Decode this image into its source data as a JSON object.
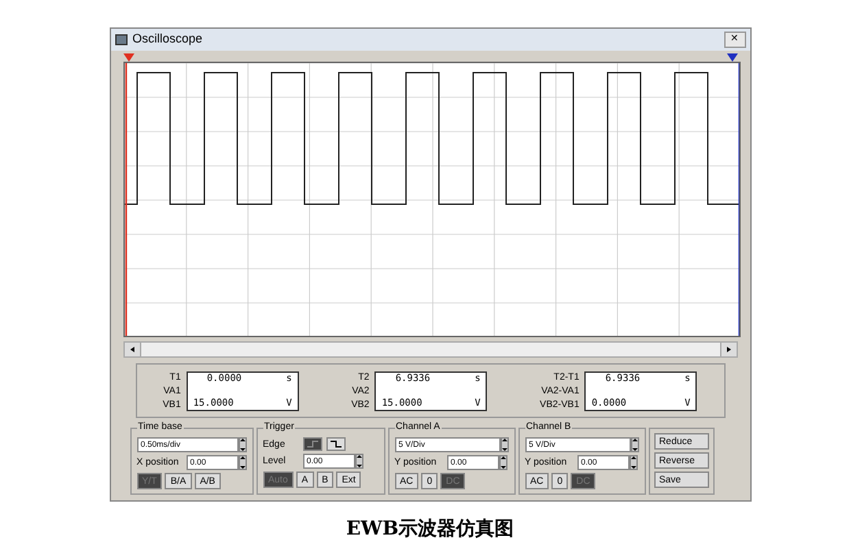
{
  "window": {
    "title": "Oscilloscope",
    "close": "✕"
  },
  "readouts": [
    {
      "labels": [
        "T1",
        "VA1",
        "VB1"
      ],
      "time": "0.0000",
      "time_unit": "s",
      "volt": "15.0000",
      "volt_unit": "V"
    },
    {
      "labels": [
        "T2",
        "VA2",
        "VB2"
      ],
      "time": "6.9336",
      "time_unit": "s",
      "volt": "15.0000",
      "volt_unit": "V"
    },
    {
      "labels": [
        "T2-T1",
        "VA2-VA1",
        "VB2-VB1"
      ],
      "time": "6.9336",
      "time_unit": "s",
      "volt": "0.0000",
      "volt_unit": "V"
    }
  ],
  "time_base": {
    "title": "Time base",
    "scale": "0.50ms/div",
    "x_label": "X position",
    "x_value": "0.00",
    "modes": [
      {
        "label": "Y/T",
        "selected": true
      },
      {
        "label": "B/A",
        "selected": false
      },
      {
        "label": "A/B",
        "selected": false
      }
    ]
  },
  "trigger": {
    "title": "Trigger",
    "edge_label": "Edge",
    "edges": [
      {
        "kind": "rising",
        "selected": true
      },
      {
        "kind": "falling",
        "selected": false
      }
    ],
    "level_label": "Level",
    "level_value": "0.00",
    "sources": [
      {
        "label": "Auto",
        "selected": true
      },
      {
        "label": "A",
        "selected": false
      },
      {
        "label": "B",
        "selected": false
      },
      {
        "label": "Ext",
        "selected": false
      }
    ]
  },
  "channels": [
    {
      "title": "Channel A",
      "scale": "5 V/Div",
      "y_label": "Y position",
      "y_value": "0.00",
      "couplings": [
        {
          "label": "AC",
          "selected": false
        },
        {
          "label": "0",
          "selected": false
        },
        {
          "label": "DC",
          "selected": true
        }
      ]
    },
    {
      "title": "Channel B",
      "scale": "5 V/Div",
      "y_label": "Y position",
      "y_value": "0.00",
      "couplings": [
        {
          "label": "AC",
          "selected": false
        },
        {
          "label": "0",
          "selected": false
        },
        {
          "label": "DC",
          "selected": true
        }
      ]
    }
  ],
  "actions": [
    "Reduce",
    "Reverse",
    "Save"
  ],
  "caption": "EWB示波器仿真图"
}
